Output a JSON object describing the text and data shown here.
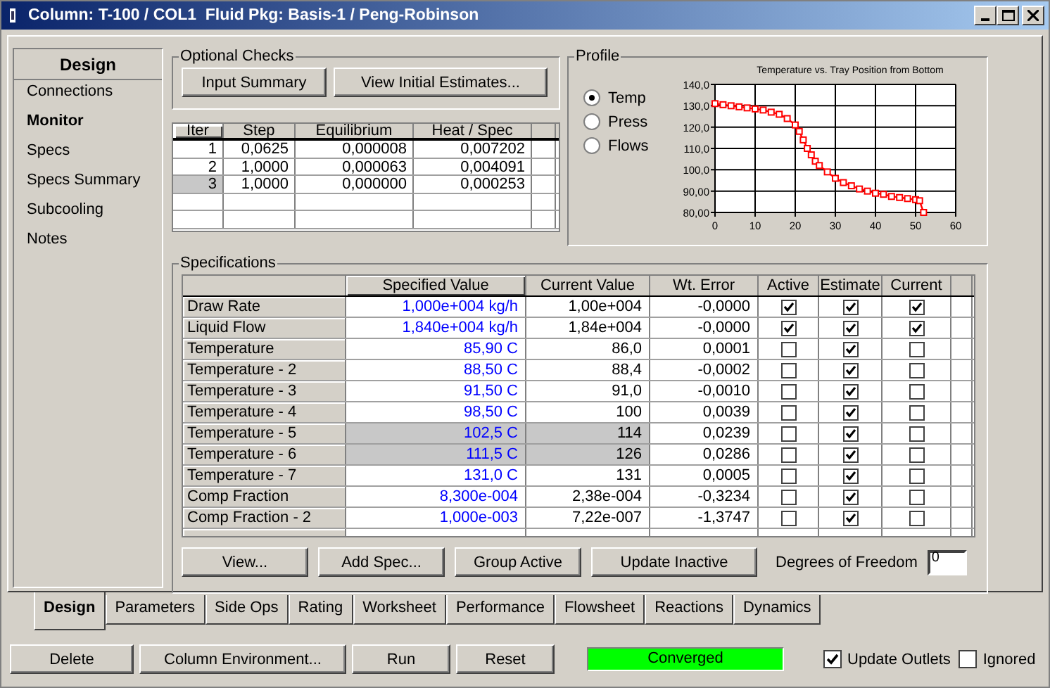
{
  "window": {
    "title": "Column: T-100 / COL1  Fluid Pkg: Basis-1 / Peng-Robinson"
  },
  "sidebar": {
    "heading": "Design",
    "items": [
      {
        "label": "Connections",
        "selected": false
      },
      {
        "label": "Monitor",
        "selected": true
      },
      {
        "label": "Specs",
        "selected": false
      },
      {
        "label": "Specs Summary",
        "selected": false
      },
      {
        "label": "Subcooling",
        "selected": false
      },
      {
        "label": "Notes",
        "selected": false
      }
    ]
  },
  "optional_checks": {
    "title": "Optional Checks",
    "buttons": [
      "Input Summary",
      "View Initial Estimates..."
    ]
  },
  "iterations": {
    "columns": [
      "Iter",
      "Step",
      "Equilibrium",
      "Heat / Spec"
    ],
    "rows": [
      {
        "cells": [
          "1",
          "0,0625",
          "0,000008",
          "0,007202"
        ],
        "selected": false
      },
      {
        "cells": [
          "2",
          "1,0000",
          "0,000063",
          "0,004091"
        ],
        "selected": false
      },
      {
        "cells": [
          "3",
          "1,0000",
          "0,000000",
          "0,000253"
        ],
        "selected": true
      }
    ]
  },
  "profile": {
    "title": "Profile",
    "options": [
      {
        "label": "Temp",
        "selected": true
      },
      {
        "label": "Press",
        "selected": false
      },
      {
        "label": "Flows",
        "selected": false
      }
    ],
    "chart_data": {
      "type": "line",
      "title": "Temperature vs. Tray Position from Bottom",
      "x": [
        0,
        2,
        4,
        6,
        8,
        10,
        12,
        14,
        16,
        18,
        20,
        21,
        22,
        23,
        24,
        25,
        26,
        28,
        30,
        32,
        34,
        36,
        38,
        40,
        42,
        44,
        46,
        48,
        50,
        51,
        52
      ],
      "grid": true,
      "series": [
        {
          "color": "#ff0000",
          "marker": "square",
          "values": [
            131,
            130.5,
            130,
            129.5,
            129,
            128.5,
            128,
            127,
            126,
            124,
            121,
            118,
            114,
            110,
            107,
            104,
            102,
            99,
            96,
            94,
            92.5,
            91,
            90,
            89,
            88.5,
            87.5,
            87,
            86.5,
            86,
            85.5,
            80
          ]
        }
      ],
      "xlim": [
        0,
        60
      ],
      "ylim": [
        80,
        140
      ],
      "xticks": [
        0,
        10,
        20,
        30,
        40,
        50,
        60
      ],
      "yticks": [
        {
          "value": 80,
          "label": "80,00"
        },
        {
          "value": 90,
          "label": "90,00"
        },
        {
          "value": 100,
          "label": "100,0"
        },
        {
          "value": 110,
          "label": "110,0"
        },
        {
          "value": 120,
          "label": "120,0"
        },
        {
          "value": 130,
          "label": "130,0"
        },
        {
          "value": 140,
          "label": "140,0"
        }
      ]
    }
  },
  "specifications": {
    "title": "Specifications",
    "columns": [
      "Specified Value",
      "Current Value",
      "Wt. Error",
      "Active",
      "Estimate",
      "Current"
    ],
    "rows": [
      {
        "name": "Draw Rate",
        "specified": "1,000e+004 kg/h",
        "current_value": "1,00e+004",
        "wt_error": "-0,0000",
        "active": true,
        "estimate": true,
        "current": true,
        "selected": false
      },
      {
        "name": "Liquid Flow",
        "specified": "1,840e+004 kg/h",
        "current_value": "1,84e+004",
        "wt_error": "-0,0000",
        "active": true,
        "estimate": true,
        "current": true,
        "selected": false
      },
      {
        "name": "Temperature",
        "specified": "85,90 C",
        "current_value": "86,0",
        "wt_error": "0,0001",
        "active": false,
        "estimate": true,
        "current": false,
        "selected": false
      },
      {
        "name": "Temperature - 2",
        "specified": "88,50 C",
        "current_value": "88,4",
        "wt_error": "-0,0002",
        "active": false,
        "estimate": true,
        "current": false,
        "selected": false
      },
      {
        "name": "Temperature - 3",
        "specified": "91,50 C",
        "current_value": "91,0",
        "wt_error": "-0,0010",
        "active": false,
        "estimate": true,
        "current": false,
        "selected": false
      },
      {
        "name": "Temperature - 4",
        "specified": "98,50 C",
        "current_value": "100",
        "wt_error": "0,0039",
        "active": false,
        "estimate": true,
        "current": false,
        "selected": false
      },
      {
        "name": "Temperature - 5",
        "specified": "102,5 C",
        "current_value": "114",
        "wt_error": "0,0239",
        "active": false,
        "estimate": true,
        "current": false,
        "selected": true
      },
      {
        "name": "Temperature - 6",
        "specified": "111,5 C",
        "current_value": "126",
        "wt_error": "0,0286",
        "active": false,
        "estimate": true,
        "current": false,
        "selected": true
      },
      {
        "name": "Temperature - 7",
        "specified": "131,0 C",
        "current_value": "131",
        "wt_error": "0,0005",
        "active": false,
        "estimate": true,
        "current": false,
        "selected": false
      },
      {
        "name": "Comp Fraction",
        "specified": "8,300e-004",
        "current_value": "2,38e-004",
        "wt_error": "-0,3234",
        "active": false,
        "estimate": true,
        "current": false,
        "selected": false
      },
      {
        "name": "Comp Fraction - 2",
        "specified": "1,000e-003",
        "current_value": "7,22e-007",
        "wt_error": "-1,3747",
        "active": false,
        "estimate": true,
        "current": false,
        "selected": false
      }
    ],
    "buttons": [
      "View...",
      "Add Spec...",
      "Group Active",
      "Update Inactive"
    ],
    "degrees_of_freedom": {
      "label": "Degrees of Freedom",
      "value": "0"
    }
  },
  "tabs": [
    {
      "label": "Design",
      "selected": true
    },
    {
      "label": "Parameters",
      "selected": false
    },
    {
      "label": "Side Ops",
      "selected": false
    },
    {
      "label": "Rating",
      "selected": false
    },
    {
      "label": "Worksheet",
      "selected": false
    },
    {
      "label": "Performance",
      "selected": false
    },
    {
      "label": "Flowsheet",
      "selected": false
    },
    {
      "label": "Reactions",
      "selected": false
    },
    {
      "label": "Dynamics",
      "selected": false
    }
  ],
  "footer": {
    "buttons": [
      "Delete",
      "Column Environment...",
      "Run",
      "Reset"
    ],
    "status": "Converged",
    "checkboxes": [
      {
        "label": "Update Outlets",
        "checked": true
      },
      {
        "label": "Ignored",
        "checked": false
      }
    ]
  }
}
